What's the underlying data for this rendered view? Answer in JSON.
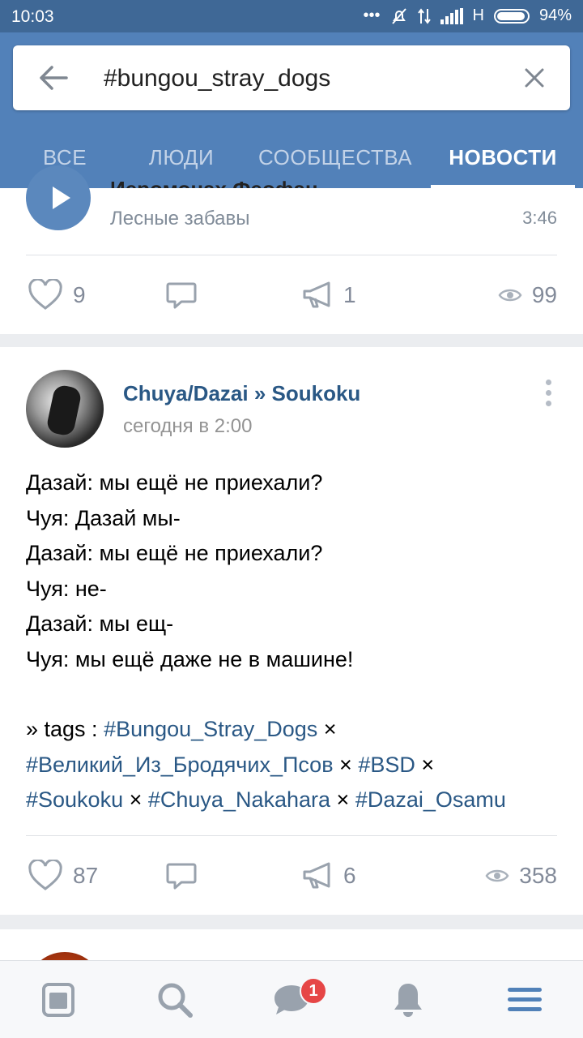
{
  "status_bar": {
    "time": "10:03",
    "network": "H",
    "battery": "94%"
  },
  "search": {
    "query": "#bungou_stray_dogs"
  },
  "tabs": [
    {
      "label": "ВСЕ"
    },
    {
      "label": "ЛЮДИ"
    },
    {
      "label": "СООБЩЕСТВА"
    },
    {
      "label": "НОВОСТИ",
      "active": true
    }
  ],
  "posts": [
    {
      "audio": {
        "title": "Иеромонах Феофан",
        "artist": "Лесные забавы",
        "duration": "3:46"
      },
      "likes": "9",
      "reposts": "1",
      "views": "99"
    },
    {
      "author": "Chuya/Dazai » Soukoku",
      "date": "сегодня в 2:00",
      "text_lines": [
        "Дазай: мы ещё не приехали?",
        "Чуя: Дазай мы-",
        "Дазай: мы ещё не приехали?",
        "Чуя: не-",
        "Дазай: мы ещ-",
        "Чуя: мы ещё даже не в машине!"
      ],
      "tags_prefix": "» tags : ",
      "tags": [
        "#Bungou_Stray_Dogs",
        "#Великий_Из_Бродячих_Псов",
        "#BSD",
        "#Soukoku",
        "#Chuya_Nakahara",
        "#Dazai_Osamu"
      ],
      "tag_separator": " × ",
      "likes": "87",
      "reposts": "6",
      "views": "358"
    }
  ],
  "bottom_nav": {
    "messages_badge": "1"
  },
  "colors": {
    "header": "#5281b9",
    "status_bar": "#3f6896",
    "link": "#2a5885",
    "badge": "#e64646"
  }
}
